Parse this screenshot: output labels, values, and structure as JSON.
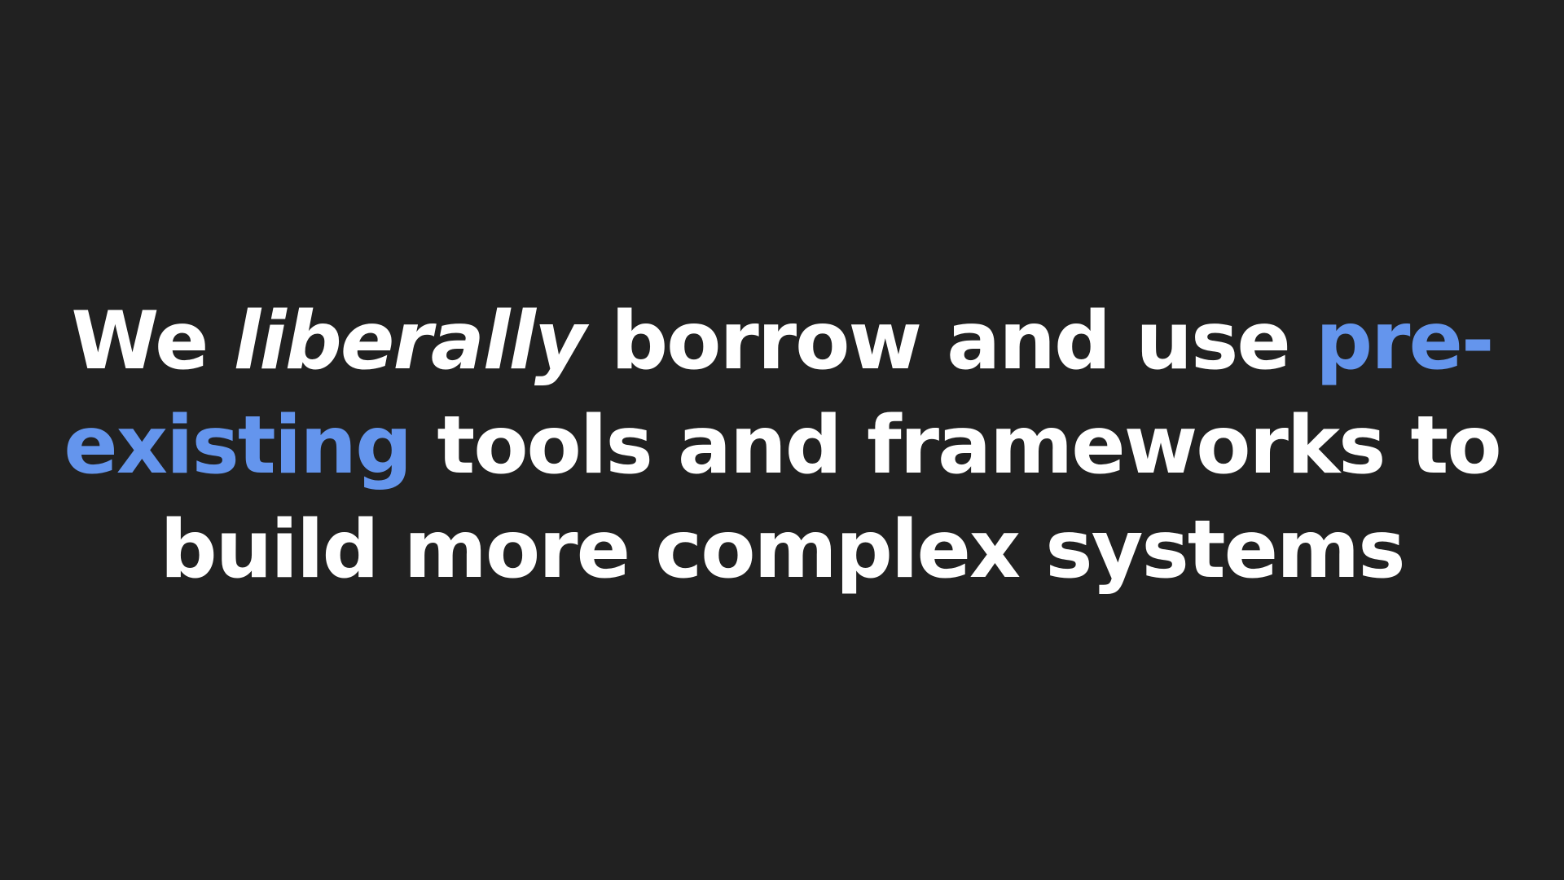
{
  "slide": {
    "background": "#212121",
    "text_color": "#ffffff",
    "accent_color": "#6495ed",
    "statement": {
      "line1_lead": "We ",
      "line1_emphasis": "liberally",
      "line1_mid": " borrow and use ",
      "line1_accent": "pre-",
      "line2_accent": "existing",
      "line2_rest": " tools and frameworks to",
      "line3": "build more complex systems"
    }
  }
}
